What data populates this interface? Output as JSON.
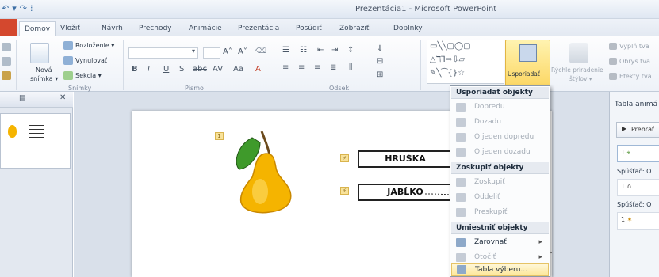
{
  "window": {
    "title": "Prezentácia1 - Microsoft PowerPoint"
  },
  "tabs": [
    {
      "label": "Domov"
    },
    {
      "label": "Vložiť"
    },
    {
      "label": "Návrh"
    },
    {
      "label": "Prechody"
    },
    {
      "label": "Animácie"
    },
    {
      "label": "Prezentácia"
    },
    {
      "label": "Posúdiť"
    },
    {
      "label": "Zobraziť"
    },
    {
      "label": "Doplnky"
    }
  ],
  "ribbon": {
    "slides_group": {
      "new_slide_line1": "Nová",
      "new_slide_line2": "snímka ▾",
      "layout": "Rozloženie ▾",
      "reset": "Vynulovať",
      "section": "Sekcia ▾",
      "label": "Snímky"
    },
    "font_group": {
      "label": "Písmo"
    },
    "paragraph_group": {
      "label": "Odsek"
    },
    "drawing_group": {
      "arrange_label": "Usporiadať",
      "quick_styles_line1": "Rýchle priradenie",
      "quick_styles_line2": "štýlov ▾",
      "fill": "Výplň tva",
      "outline": "Obrys tva",
      "effects": "Efekty tva"
    }
  },
  "slide": {
    "word1": "HRUŠKA",
    "word2": "JABĹKO",
    "tag1": "1"
  },
  "animation_pane": {
    "title": "Tabla animá",
    "play_label": "Prehrať",
    "trigger1": "Spúšťač: O",
    "trigger2": "Spúšťač: O",
    "item_num": "1"
  },
  "menu": {
    "sections": [
      {
        "title": "Usporiadať objekty",
        "items": [
          {
            "label": "Dopredu",
            "disabled": true
          },
          {
            "label": "Dozadu",
            "disabled": true
          },
          {
            "label": "O jeden dopredu",
            "disabled": true
          },
          {
            "label": "O jeden dozadu",
            "disabled": true
          }
        ]
      },
      {
        "title": "Zoskupiť objekty",
        "items": [
          {
            "label": "Zoskupiť",
            "disabled": true
          },
          {
            "label": "Oddeliť",
            "disabled": true
          },
          {
            "label": "Preskupiť",
            "disabled": true
          }
        ]
      },
      {
        "title": "Umiestniť objekty",
        "items": [
          {
            "label": "Zarovnať",
            "disabled": false,
            "submenu": true
          },
          {
            "label": "Otočiť",
            "disabled": true,
            "submenu": true
          },
          {
            "label": "Tabla výberu...",
            "disabled": false,
            "hover": true
          }
        ]
      }
    ]
  },
  "colors": {
    "accent_highlight": "#fcd764",
    "file_tab": "#d4482e",
    "pear_body": "#f5b400",
    "pear_leaf": "#3f9a2b"
  }
}
